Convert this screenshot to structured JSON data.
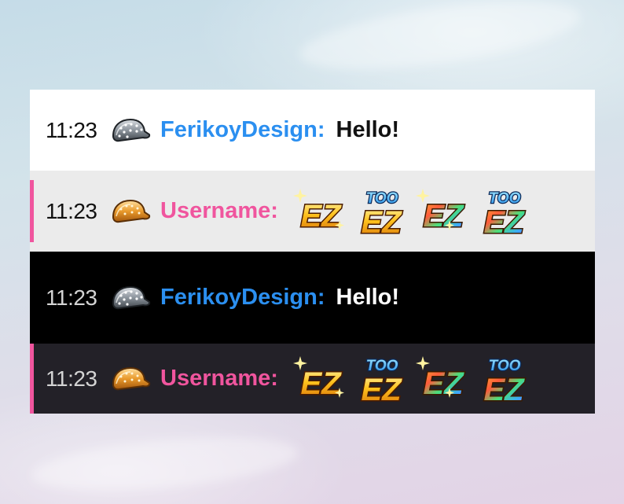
{
  "colors": {
    "username_blue": "#2b8ff0",
    "username_pink": "#f0559e",
    "row_white": "#ffffff",
    "row_light_gray": "#ebebeb",
    "row_black": "#000000",
    "row_dark": "#232128"
  },
  "chat": {
    "messages": [
      {
        "timestamp": "11:23",
        "badge_icon": "silver-cap-icon",
        "username": "FerikoyDesign:",
        "text": "Hello!"
      },
      {
        "timestamp": "11:23",
        "badge_icon": "gold-cap-icon",
        "username": "Username:",
        "emotes": [
          "ez-gold-emote",
          "too-ez-gold-emote",
          "ez-rainbow-emote",
          "too-ez-rainbow-emote"
        ]
      },
      {
        "timestamp": "11:23",
        "badge_icon": "silver-cap-icon",
        "username": "FerikoyDesign:",
        "text": "Hello!"
      },
      {
        "timestamp": "11:23",
        "badge_icon": "gold-cap-icon",
        "username": "Username:",
        "emotes": [
          "ez-gold-emote",
          "too-ez-gold-emote",
          "ez-rainbow-emote",
          "too-ez-rainbow-emote"
        ]
      }
    ]
  }
}
